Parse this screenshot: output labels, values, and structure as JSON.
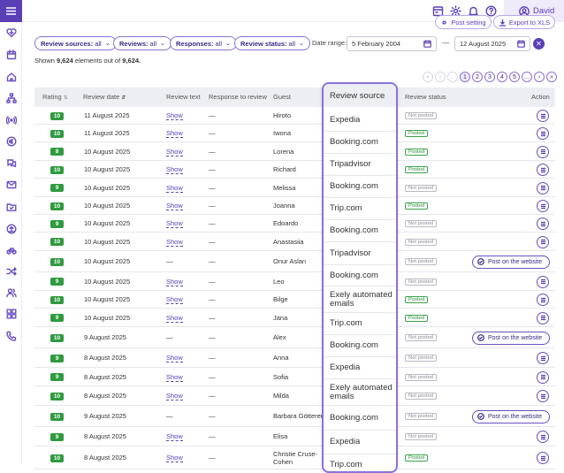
{
  "topbar": {
    "user_name": "David",
    "post_setting_label": "Post setting",
    "export_label": "Export to XLS"
  },
  "filters": {
    "review_sources": {
      "label": "Review sources:",
      "value": "all"
    },
    "reviews": {
      "label": "Reviews:",
      "value": "all"
    },
    "responses": {
      "label": "Responses:",
      "value": "all"
    },
    "review_status": {
      "label": "Review status:",
      "value": "all"
    },
    "date_range_label": "Date range:",
    "date_from": "5 February 2004",
    "date_to": "12 August 2025",
    "date_separator": "—",
    "clear_symbol": "✕"
  },
  "summary": {
    "prefix": "Shown",
    "shown": "9,624",
    "middle": "elements out of",
    "total": "9,624."
  },
  "pager": {
    "first": "«",
    "prev": "‹",
    "ellipsis_left": "…",
    "pages": [
      "1",
      "2",
      "3",
      "4",
      "5"
    ],
    "ellipsis_right": "…",
    "next": "›",
    "last": "»"
  },
  "columns": {
    "rating": "Rating",
    "review_date": "Review date",
    "review_text": "Review text",
    "response": "Response to review",
    "guest": "Guest",
    "review_source": "Review source",
    "review_status": "Review status",
    "action": "Action"
  },
  "rows": [
    {
      "rating": "10",
      "date": "11 August 2025",
      "text": "Show",
      "response": "—",
      "guest": "Hiroto",
      "source": "Expedia",
      "status": "Not posted",
      "action": "menu"
    },
    {
      "rating": "10",
      "date": "11 August 2025",
      "text": "Show",
      "response": "—",
      "guest": "Iwona",
      "source": "Booking.com",
      "status": "Posted",
      "action": "menu"
    },
    {
      "rating": "8",
      "date": "10 August 2025",
      "text": "Show",
      "response": "—",
      "guest": "Lorena",
      "source": "Tripadvisor",
      "status": "Posted",
      "action": "menu"
    },
    {
      "rating": "10",
      "date": "10 August 2025",
      "text": "Show",
      "response": "—",
      "guest": "Richard",
      "source": "Booking.com",
      "status": "Posted",
      "action": "menu"
    },
    {
      "rating": "9",
      "date": "10 August 2025",
      "text": "Show",
      "response": "—",
      "guest": "Melissa",
      "source": "Trip.com",
      "status": "Not posted",
      "action": "menu"
    },
    {
      "rating": "10",
      "date": "10 August 2025",
      "text": "Show",
      "response": "—",
      "guest": "Joanna",
      "source": "Booking.com",
      "status": "Posted",
      "action": "menu"
    },
    {
      "rating": "9",
      "date": "10 August 2025",
      "text": "Show",
      "response": "—",
      "guest": "Edoardo",
      "source": "Tripadvisor",
      "status": "Not posted",
      "action": "menu"
    },
    {
      "rating": "10",
      "date": "10 August 2025",
      "text": "Show",
      "response": "—",
      "guest": "Anastasiia",
      "source": "Booking.com",
      "status": "Not posted",
      "action": "menu"
    },
    {
      "rating": "10",
      "date": "10 August 2025",
      "text": "—",
      "response": "—",
      "guest": "Onur Aslan",
      "source": "Exely automated emails",
      "status": "Not posted",
      "action": "post"
    },
    {
      "rating": "9",
      "date": "10 August 2025",
      "text": "Show",
      "response": "—",
      "guest": "Leo",
      "source": "Trip.com",
      "status": "Not posted",
      "action": "menu"
    },
    {
      "rating": "10",
      "date": "10 August 2025",
      "text": "Show",
      "response": "—",
      "guest": "Bilge",
      "source": "Booking.com",
      "status": "Posted",
      "action": "menu"
    },
    {
      "rating": "9",
      "date": "10 August 2025",
      "text": "Show",
      "response": "—",
      "guest": "Jana",
      "source": "Expedia",
      "status": "Posted",
      "action": "menu"
    },
    {
      "rating": "10",
      "date": "9 August 2025",
      "text": "—",
      "response": "—",
      "guest": "Alex",
      "source": "Exely automated emails",
      "status": "Not posted",
      "action": "post"
    },
    {
      "rating": "9",
      "date": "8 August 2025",
      "text": "Show",
      "response": "—",
      "guest": "Anna",
      "source": "Booking.com",
      "status": "Not posted",
      "action": "menu"
    },
    {
      "rating": "9",
      "date": "8 August 2025",
      "text": "Show",
      "response": "—",
      "guest": "Sofia",
      "source": "Expedia",
      "status": "Not posted",
      "action": "menu"
    },
    {
      "rating": "10",
      "date": "8 August 2025",
      "text": "Show",
      "response": "—",
      "guest": "Milda",
      "source": "Trip.com",
      "status": "Not posted",
      "action": "menu"
    },
    {
      "rating": "10",
      "date": "9 August 2025",
      "text": "—",
      "response": "—",
      "guest": "Barbara Götterer",
      "source": "",
      "status": "Not posted",
      "action": "post"
    },
    {
      "rating": "9",
      "date": "8 August 2025",
      "text": "Show",
      "response": "—",
      "guest": "Elisa",
      "source": "",
      "status": "Not posted",
      "action": "menu"
    },
    {
      "rating": "10",
      "date": "8 August 2025",
      "text": "Show",
      "response": "—",
      "guest": "Christie Cruse-Cohen",
      "source": "",
      "status": "Posted",
      "action": "menu"
    }
  ],
  "post_button_label": "Post on the website",
  "source_column": {
    "header": "Review source",
    "cells": [
      "Expedia",
      "Booking.com",
      "Tripadvisor",
      "Booking.com",
      "Trip.com",
      "Booking.com",
      "Tripadvisor",
      "Booking.com",
      "Exely automated emails",
      "Trip.com",
      "Booking.com",
      "Expedia",
      "Exely automated emails",
      "Booking.com",
      "Expedia",
      "Trip.com"
    ]
  },
  "colors": {
    "accent": "#5b3fb6",
    "rating_green": "#2f9a3f",
    "posted_green": "#3aa34b",
    "header_bg": "#eceef4"
  }
}
